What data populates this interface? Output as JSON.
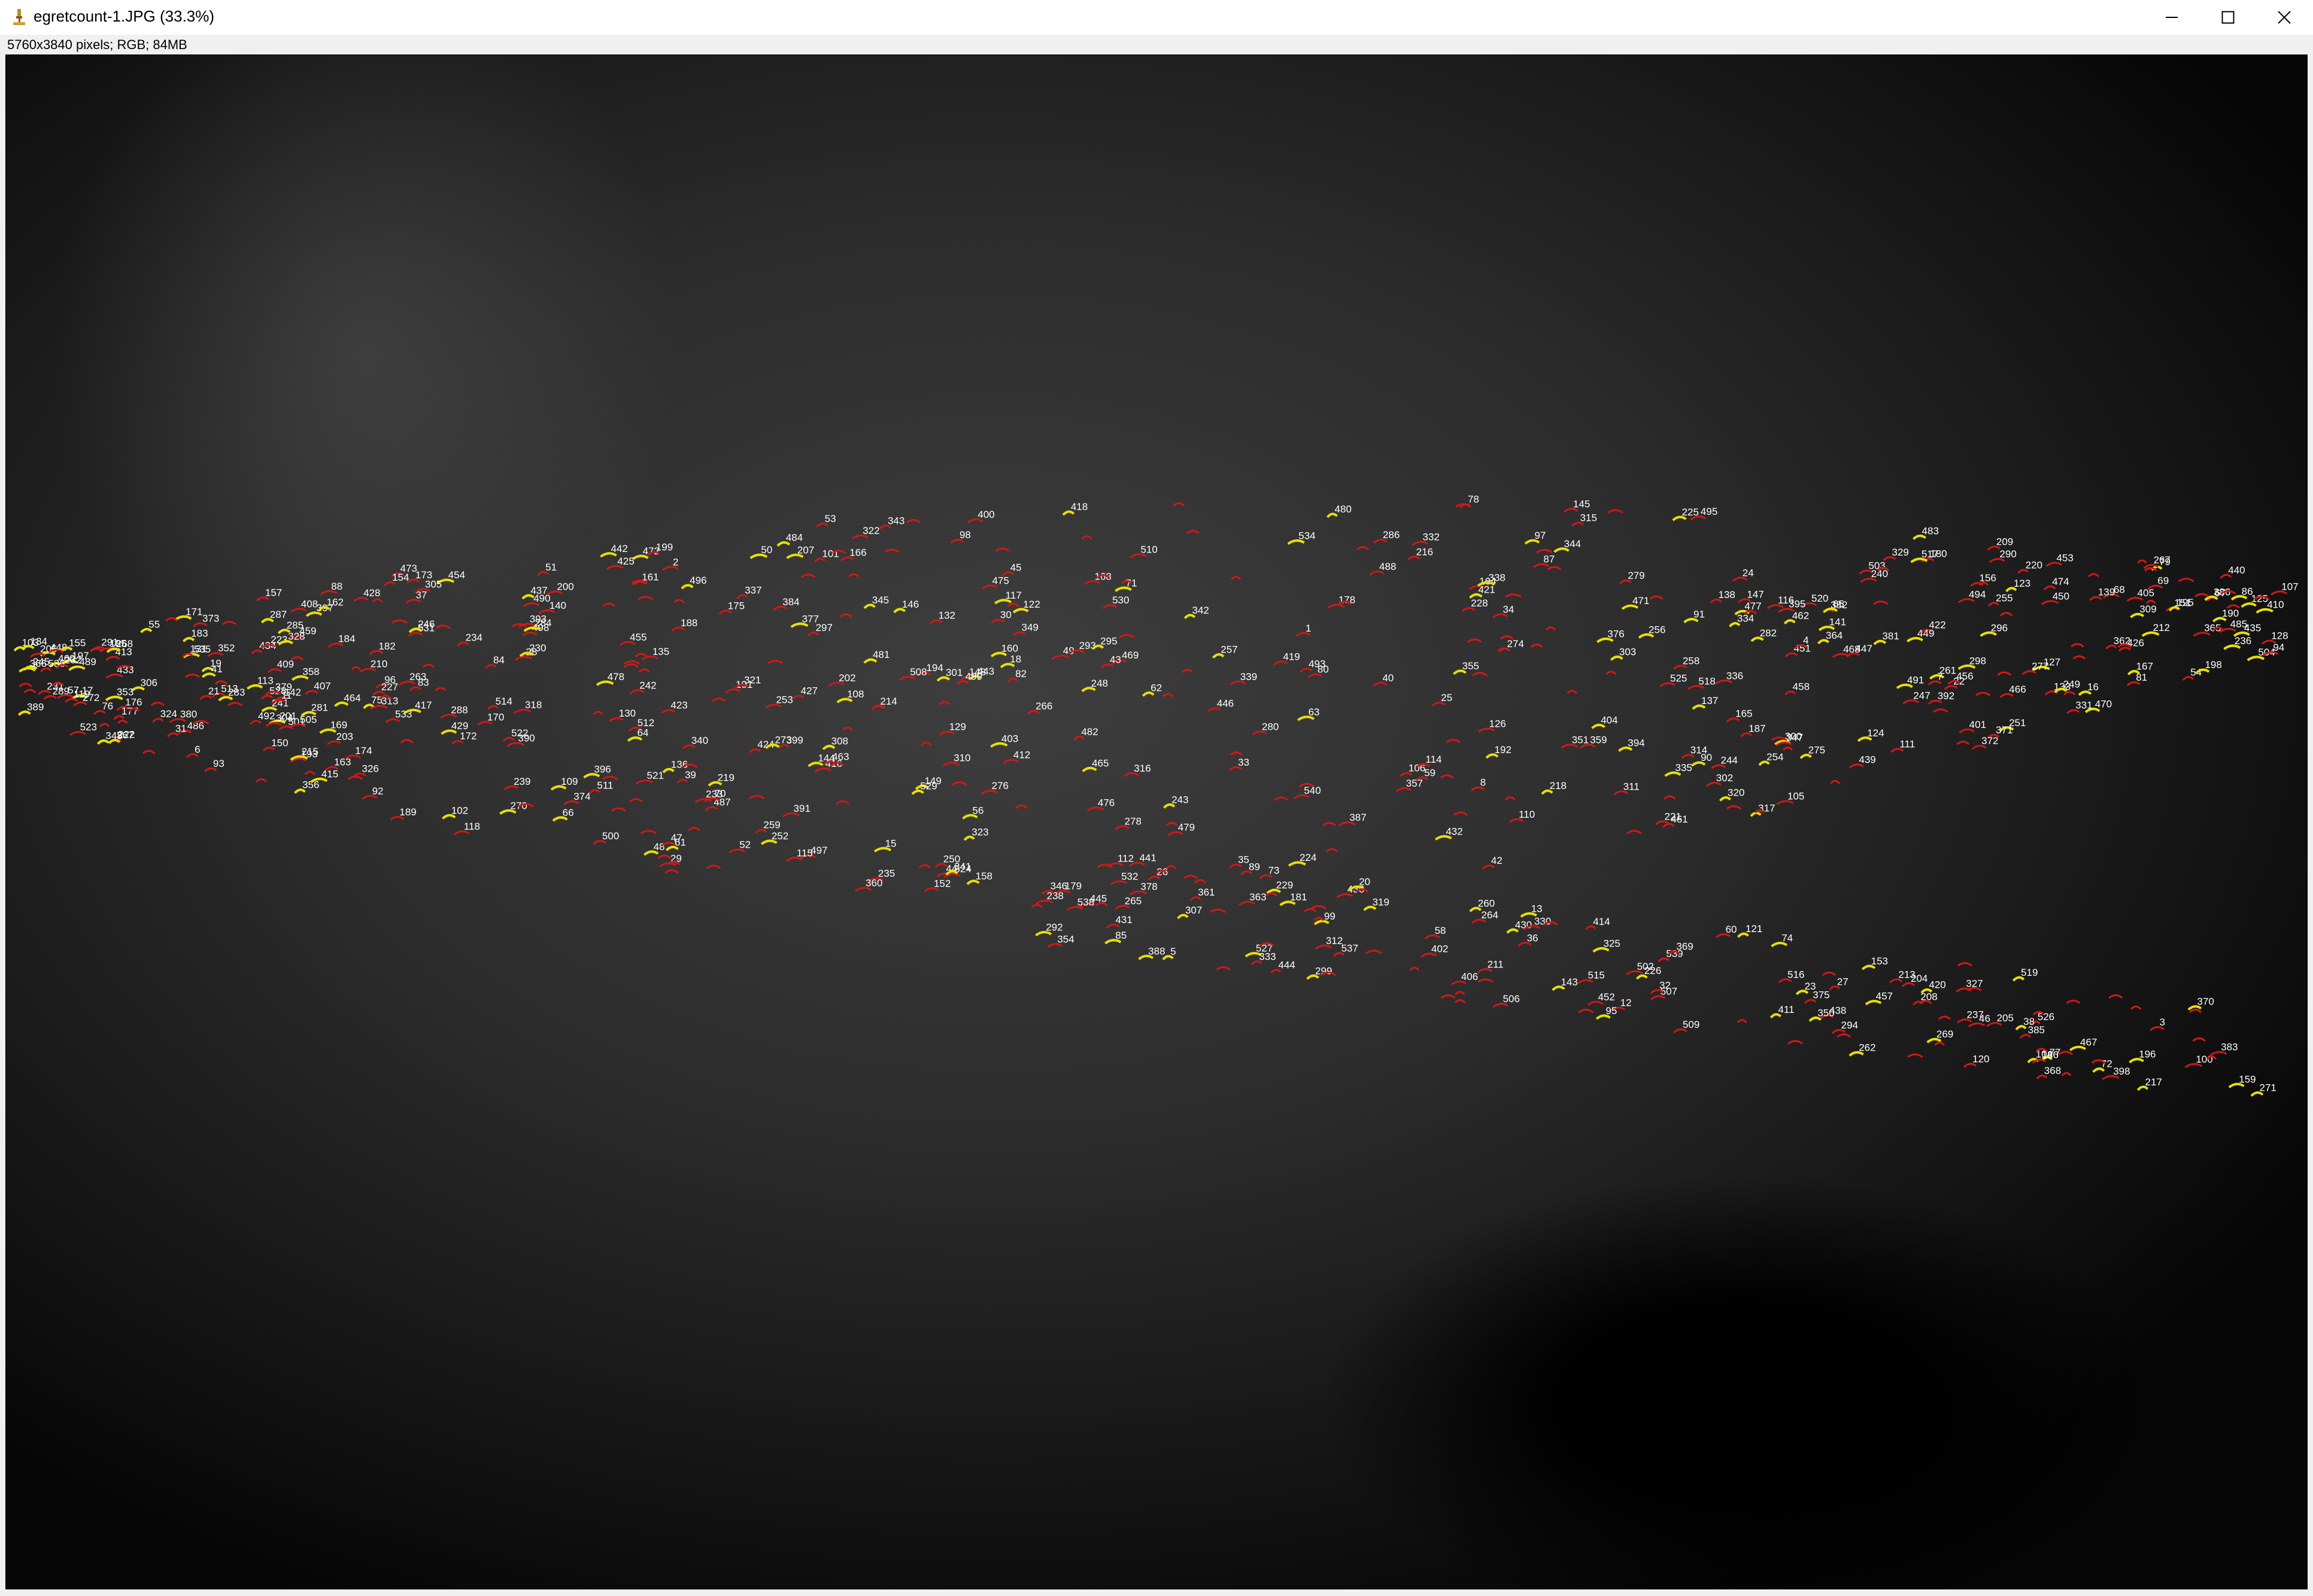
{
  "window": {
    "title": "egretcount-1.JPG (33.3%)",
    "app_icon": "imagej-microscope-icon",
    "controls": [
      "minimize-icon",
      "maximize-icon",
      "close-icon"
    ]
  },
  "image_info": "5760x3840 pixels; RGB; 84MB",
  "canvas": {
    "description_icon": "photo-canvas",
    "label_color": "#ffffff",
    "yellow_bird_color": "#e8e000",
    "red_bird_color": "#d01818",
    "count_labels": [
      "34",
      "87",
      "91",
      "140",
      "180",
      "135",
      "148",
      "182",
      "190",
      "205",
      "241",
      "149",
      "194",
      "197",
      "245",
      "239",
      "261",
      "266",
      "265",
      "289",
      "294",
      "288",
      "299",
      "292",
      "301",
      "311",
      "327",
      "351",
      "344",
      "349",
      "345",
      "363",
      "382",
      "385",
      "397",
      "394",
      "398",
      "393",
      "396",
      "423",
      "414",
      "407",
      "404",
      "403",
      "426",
      "433",
      "440",
      "450",
      "451",
      "458",
      "467",
      "461",
      "459",
      "455",
      "452",
      "437",
      "427",
      "424",
      "413",
      "406",
      "402",
      "400",
      "438",
      "445",
      "446",
      "442",
      "441",
      "436",
      "435",
      "416",
      "418",
      "410",
      "412",
      "411",
      "422",
      "428",
      "430",
      "434",
      "431",
      "448",
      "457",
      "460",
      "443",
      "453",
      "454",
      "462",
      "463",
      "465",
      "466",
      "464",
      "468",
      "469",
      "470",
      "471",
      "472",
      "473",
      "474",
      "475",
      "476",
      "477",
      "478",
      "479",
      "480",
      "481",
      "482",
      "483",
      "484",
      "485",
      "486",
      "487",
      "488",
      "489",
      "490",
      "491",
      "492",
      "493",
      "494",
      "495",
      "496",
      "497",
      "498",
      "499",
      "500",
      "501",
      "502",
      "503",
      "504",
      "505",
      "506",
      "507",
      "508",
      "509",
      "510",
      "511",
      "512",
      "513",
      "514",
      "515",
      "516",
      "517",
      "518",
      "519",
      "520",
      "521",
      "522",
      "523",
      "524",
      "525",
      "526",
      "527",
      "528",
      "529",
      "530",
      "531",
      "532",
      "533",
      "534",
      "535",
      "536",
      "537",
      "538",
      "539",
      "540",
      "38",
      "113",
      "103",
      "80",
      "143",
      "150",
      "171",
      "168",
      "152",
      "161",
      "176",
      "181",
      "170",
      "172",
      "173",
      "167",
      "174",
      "164",
      "145",
      "158",
      "154",
      "165",
      "155",
      "142",
      "138",
      "131",
      "123",
      "127",
      "105",
      "90",
      "64",
      "48",
      "59",
      "49",
      "27",
      "24",
      "31",
      "33",
      "26",
      "25",
      "32",
      "44",
      "36",
      "17",
      "16",
      "22",
      "8",
      "6",
      "3",
      "1",
      "4",
      "2",
      "5",
      "7",
      "11",
      "12",
      "13",
      "15",
      "18",
      "19",
      "20",
      "21",
      "23",
      "28",
      "29",
      "30",
      "35",
      "37",
      "39",
      "40",
      "41",
      "42",
      "43",
      "45",
      "46",
      "47",
      "50",
      "51",
      "52",
      "53",
      "54",
      "55",
      "56",
      "57",
      "58",
      "60",
      "61",
      "62",
      "63",
      "65",
      "66",
      "67",
      "68",
      "69",
      "70",
      "71",
      "72",
      "73",
      "74",
      "75",
      "76",
      "77",
      "78",
      "79",
      "81",
      "82",
      "83",
      "84",
      "85",
      "86",
      "88",
      "89",
      "92",
      "93",
      "94",
      "95",
      "96",
      "97",
      "98",
      "99",
      "100",
      "101",
      "102",
      "104",
      "106",
      "107",
      "108",
      "109",
      "110",
      "111",
      "112",
      "114",
      "115",
      "116",
      "117",
      "118",
      "119",
      "120",
      "121",
      "122",
      "124",
      "125",
      "126",
      "128",
      "129",
      "130",
      "132",
      "133",
      "134",
      "136",
      "137",
      "139",
      "141",
      "144",
      "146",
      "147",
      "151",
      "153",
      "156",
      "157",
      "159",
      "160",
      "162",
      "163",
      "166",
      "169",
      "175",
      "177",
      "178",
      "179",
      "183",
      "184",
      "185",
      "186",
      "187",
      "188",
      "189",
      "191",
      "192",
      "193",
      "195",
      "196",
      "198",
      "199",
      "200",
      "201",
      "202",
      "203",
      "204",
      "206",
      "207",
      "208",
      "209",
      "210",
      "211",
      "212",
      "213",
      "214",
      "215",
      "216",
      "217",
      "218",
      "219",
      "220",
      "221",
      "222",
      "223",
      "224",
      "225",
      "226",
      "227",
      "228",
      "229",
      "230",
      "231",
      "232",
      "233",
      "234",
      "235",
      "236",
      "237",
      "238",
      "240",
      "242",
      "243",
      "244",
      "246",
      "247",
      "248",
      "249",
      "250",
      "251",
      "252",
      "253",
      "254",
      "255",
      "256",
      "257",
      "258",
      "259",
      "260",
      "262",
      "263",
      "264",
      "267",
      "268",
      "269",
      "270",
      "271",
      "272",
      "273",
      "274",
      "275",
      "276",
      "277",
      "278",
      "279",
      "280",
      "281",
      "282",
      "283",
      "284",
      "285",
      "286",
      "287",
      "290",
      "291",
      "293",
      "295",
      "296",
      "297",
      "298",
      "300",
      "302",
      "303",
      "304",
      "305",
      "306",
      "307",
      "308",
      "309",
      "310",
      "312",
      "313",
      "314",
      "315",
      "316",
      "317",
      "318",
      "319",
      "320",
      "321",
      "322",
      "323",
      "324",
      "325",
      "326",
      "328",
      "329",
      "330",
      "331",
      "332",
      "333",
      "334",
      "335",
      "336",
      "337",
      "338",
      "339",
      "340",
      "341",
      "342",
      "343",
      "346",
      "347",
      "348",
      "350",
      "352",
      "353",
      "354",
      "355",
      "356",
      "357",
      "358",
      "359",
      "360",
      "361",
      "362",
      "364",
      "365",
      "366",
      "367",
      "368",
      "369",
      "370",
      "371",
      "372",
      "373",
      "374",
      "375",
      "376",
      "377",
      "378",
      "379",
      "380",
      "381",
      "383",
      "384",
      "386",
      "387",
      "388",
      "389",
      "390",
      "391",
      "392",
      "395",
      "399",
      "401",
      "405",
      "408",
      "409",
      "415",
      "417",
      "419",
      "420",
      "421",
      "425",
      "429",
      "432",
      "439",
      "444",
      "447",
      "449",
      "456"
    ]
  }
}
